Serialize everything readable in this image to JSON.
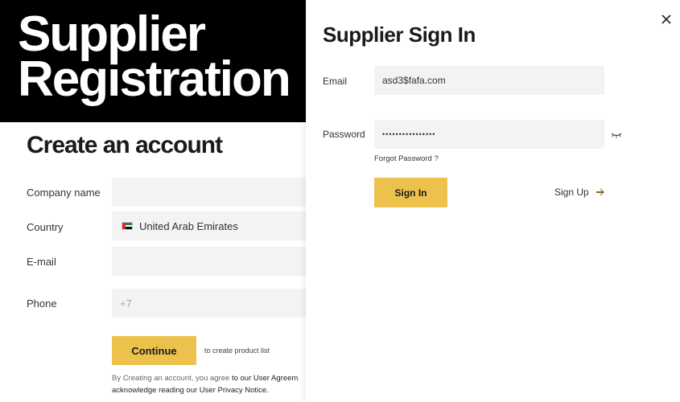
{
  "registration": {
    "hero_line_1": "Supplier",
    "hero_line_2": "Registration",
    "heading": "Create an account",
    "fields": {
      "company_label": "Company name",
      "country_label": "Country",
      "country_value": "United Arab Emirates",
      "email_label": "E-mail",
      "phone_label": "Phone",
      "phone_placeholder": "+7"
    },
    "continue_label": "Continue",
    "continue_hint": "to create product list",
    "disclaimer_line_1_prefix": "By Creating an account, you agree ",
    "disclaimer_line_1_link": "to our User Agreem",
    "disclaimer_line_2": "acknowledge reading our User Privacy Notice."
  },
  "signin": {
    "title": "Supplier Sign In",
    "email_label": "Email",
    "email_value": "asd3$fafa.com",
    "password_label": "Password",
    "password_value": "••••••••••••••••",
    "forgot_label": "Forgot Password ?",
    "signin_label": "Sign In",
    "signup_label": "Sign Up"
  },
  "colors": {
    "accent": "#ecc24d",
    "hero_bg": "#000000",
    "field_bg": "#f3f3f3"
  },
  "icons": [
    "close-icon",
    "eye-closed-icon",
    "arrow-right-icon",
    "uae-flag-icon"
  ]
}
